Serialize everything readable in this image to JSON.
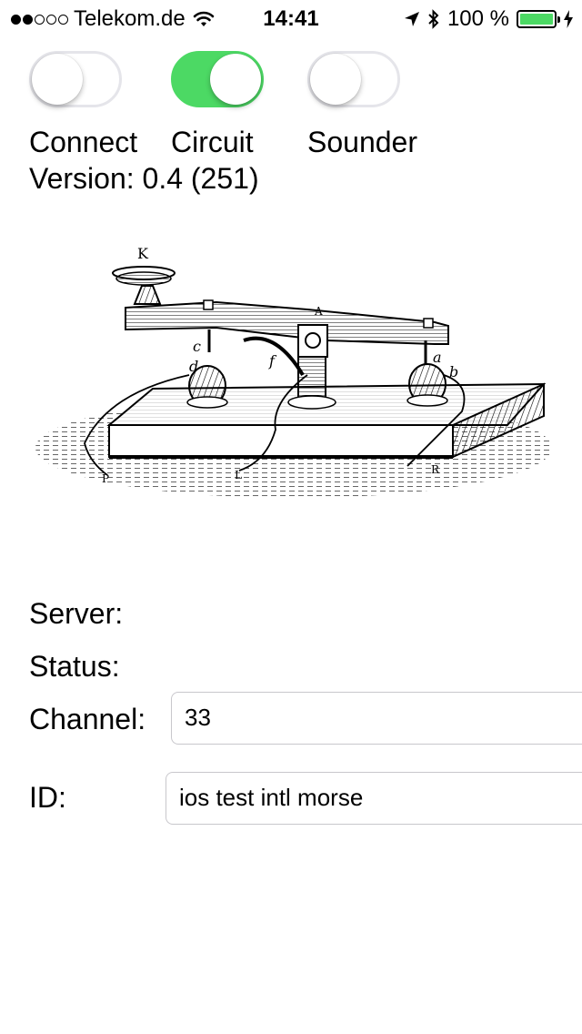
{
  "status_bar": {
    "signal_dots": [
      true,
      true,
      false,
      false,
      false
    ],
    "carrier": "Telekom.de",
    "time": "14:41",
    "battery_text": "100 %",
    "battery_level": 1.0,
    "icons": [
      "wifi-icon",
      "location-arrow-icon",
      "bluetooth-icon",
      "battery-icon",
      "charging-bolt-icon"
    ]
  },
  "switches": [
    {
      "label": "Connect",
      "on": false
    },
    {
      "label": "Circuit",
      "on": true
    },
    {
      "label": "Sounder",
      "on": false
    }
  ],
  "version_text": "Version: 0.4 (251)",
  "illustration_letters": [
    "K",
    "A",
    "c",
    "d",
    "f",
    "a",
    "b",
    "P",
    "L",
    "R"
  ],
  "form": {
    "server_label": "Server:",
    "status_label": "Status:",
    "channel_label": "Channel:",
    "channel_value": "33",
    "id_label": "ID:",
    "id_value": "ios test intl morse"
  },
  "colors": {
    "switch_on": "#4cd964",
    "switch_off_border": "#e5e5ea",
    "battery_fill": "#4cd964",
    "field_border": "#c8c7cc"
  }
}
